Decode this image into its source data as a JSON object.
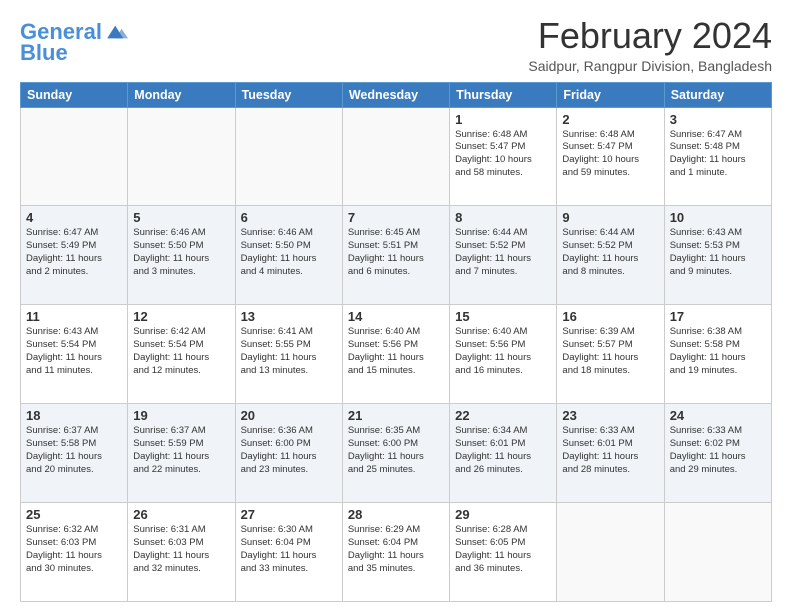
{
  "header": {
    "logo_line1": "General",
    "logo_line2": "Blue",
    "title": "February 2024",
    "subtitle": "Saidpur, Rangpur Division, Bangladesh"
  },
  "days": [
    "Sunday",
    "Monday",
    "Tuesday",
    "Wednesday",
    "Thursday",
    "Friday",
    "Saturday"
  ],
  "weeks": [
    [
      {
        "day": "",
        "info": ""
      },
      {
        "day": "",
        "info": ""
      },
      {
        "day": "",
        "info": ""
      },
      {
        "day": "",
        "info": ""
      },
      {
        "day": "1",
        "info": "Sunrise: 6:48 AM\nSunset: 5:47 PM\nDaylight: 10 hours\nand 58 minutes."
      },
      {
        "day": "2",
        "info": "Sunrise: 6:48 AM\nSunset: 5:47 PM\nDaylight: 10 hours\nand 59 minutes."
      },
      {
        "day": "3",
        "info": "Sunrise: 6:47 AM\nSunset: 5:48 PM\nDaylight: 11 hours\nand 1 minute."
      }
    ],
    [
      {
        "day": "4",
        "info": "Sunrise: 6:47 AM\nSunset: 5:49 PM\nDaylight: 11 hours\nand 2 minutes."
      },
      {
        "day": "5",
        "info": "Sunrise: 6:46 AM\nSunset: 5:50 PM\nDaylight: 11 hours\nand 3 minutes."
      },
      {
        "day": "6",
        "info": "Sunrise: 6:46 AM\nSunset: 5:50 PM\nDaylight: 11 hours\nand 4 minutes."
      },
      {
        "day": "7",
        "info": "Sunrise: 6:45 AM\nSunset: 5:51 PM\nDaylight: 11 hours\nand 6 minutes."
      },
      {
        "day": "8",
        "info": "Sunrise: 6:44 AM\nSunset: 5:52 PM\nDaylight: 11 hours\nand 7 minutes."
      },
      {
        "day": "9",
        "info": "Sunrise: 6:44 AM\nSunset: 5:52 PM\nDaylight: 11 hours\nand 8 minutes."
      },
      {
        "day": "10",
        "info": "Sunrise: 6:43 AM\nSunset: 5:53 PM\nDaylight: 11 hours\nand 9 minutes."
      }
    ],
    [
      {
        "day": "11",
        "info": "Sunrise: 6:43 AM\nSunset: 5:54 PM\nDaylight: 11 hours\nand 11 minutes."
      },
      {
        "day": "12",
        "info": "Sunrise: 6:42 AM\nSunset: 5:54 PM\nDaylight: 11 hours\nand 12 minutes."
      },
      {
        "day": "13",
        "info": "Sunrise: 6:41 AM\nSunset: 5:55 PM\nDaylight: 11 hours\nand 13 minutes."
      },
      {
        "day": "14",
        "info": "Sunrise: 6:40 AM\nSunset: 5:56 PM\nDaylight: 11 hours\nand 15 minutes."
      },
      {
        "day": "15",
        "info": "Sunrise: 6:40 AM\nSunset: 5:56 PM\nDaylight: 11 hours\nand 16 minutes."
      },
      {
        "day": "16",
        "info": "Sunrise: 6:39 AM\nSunset: 5:57 PM\nDaylight: 11 hours\nand 18 minutes."
      },
      {
        "day": "17",
        "info": "Sunrise: 6:38 AM\nSunset: 5:58 PM\nDaylight: 11 hours\nand 19 minutes."
      }
    ],
    [
      {
        "day": "18",
        "info": "Sunrise: 6:37 AM\nSunset: 5:58 PM\nDaylight: 11 hours\nand 20 minutes."
      },
      {
        "day": "19",
        "info": "Sunrise: 6:37 AM\nSunset: 5:59 PM\nDaylight: 11 hours\nand 22 minutes."
      },
      {
        "day": "20",
        "info": "Sunrise: 6:36 AM\nSunset: 6:00 PM\nDaylight: 11 hours\nand 23 minutes."
      },
      {
        "day": "21",
        "info": "Sunrise: 6:35 AM\nSunset: 6:00 PM\nDaylight: 11 hours\nand 25 minutes."
      },
      {
        "day": "22",
        "info": "Sunrise: 6:34 AM\nSunset: 6:01 PM\nDaylight: 11 hours\nand 26 minutes."
      },
      {
        "day": "23",
        "info": "Sunrise: 6:33 AM\nSunset: 6:01 PM\nDaylight: 11 hours\nand 28 minutes."
      },
      {
        "day": "24",
        "info": "Sunrise: 6:33 AM\nSunset: 6:02 PM\nDaylight: 11 hours\nand 29 minutes."
      }
    ],
    [
      {
        "day": "25",
        "info": "Sunrise: 6:32 AM\nSunset: 6:03 PM\nDaylight: 11 hours\nand 30 minutes."
      },
      {
        "day": "26",
        "info": "Sunrise: 6:31 AM\nSunset: 6:03 PM\nDaylight: 11 hours\nand 32 minutes."
      },
      {
        "day": "27",
        "info": "Sunrise: 6:30 AM\nSunset: 6:04 PM\nDaylight: 11 hours\nand 33 minutes."
      },
      {
        "day": "28",
        "info": "Sunrise: 6:29 AM\nSunset: 6:04 PM\nDaylight: 11 hours\nand 35 minutes."
      },
      {
        "day": "29",
        "info": "Sunrise: 6:28 AM\nSunset: 6:05 PM\nDaylight: 11 hours\nand 36 minutes."
      },
      {
        "day": "",
        "info": ""
      },
      {
        "day": "",
        "info": ""
      }
    ]
  ]
}
